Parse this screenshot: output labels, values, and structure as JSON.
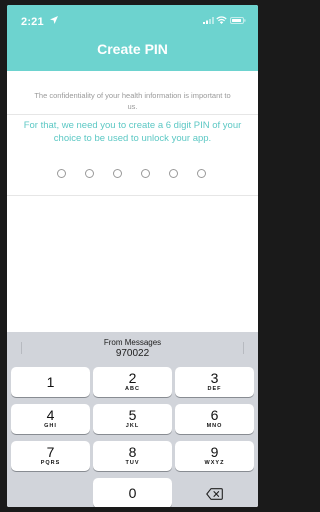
{
  "status": {
    "time": "2:21"
  },
  "header": {
    "title": "Create PIN"
  },
  "content": {
    "description": "The confidentiality of your health information is important to us.",
    "instruction": "For that, we need you to create a 6 digit PIN of your choice to be used to unlock your app.",
    "pin": {
      "length": 6,
      "filled": 0
    }
  },
  "keyboard": {
    "suggestion_label": "From Messages",
    "suggestion_code": "970022",
    "keys": [
      {
        "digit": "1",
        "letters": ""
      },
      {
        "digit": "2",
        "letters": "ABC"
      },
      {
        "digit": "3",
        "letters": "DEF"
      },
      {
        "digit": "4",
        "letters": "GHI"
      },
      {
        "digit": "5",
        "letters": "JKL"
      },
      {
        "digit": "6",
        "letters": "MNO"
      },
      {
        "digit": "7",
        "letters": "PQRS"
      },
      {
        "digit": "8",
        "letters": "TUV"
      },
      {
        "digit": "9",
        "letters": "WXYZ"
      },
      {
        "digit": "0",
        "letters": ""
      }
    ],
    "delete_icon": "backspace-icon"
  },
  "colors": {
    "accent": "#6dd3cf",
    "instruction": "#5cc8c4",
    "keyboard_bg": "#d1d4da"
  }
}
